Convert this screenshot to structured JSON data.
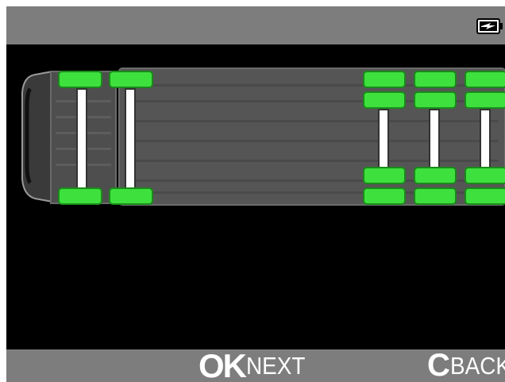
{
  "status_bar": {
    "battery_icon": "battery-charging-icon"
  },
  "vehicle": {
    "axle_count": 5,
    "tire_status_color": "#3ee03e",
    "body_color": "#5a5a5a"
  },
  "softkeys": {
    "ok_key": "OK",
    "ok_label": "NEXT",
    "back_key": "C",
    "back_label": "BACK"
  },
  "colors": {
    "bar_background": "#7d7d7d",
    "screen_background": "#000000",
    "tire_ok": "#3ee03e",
    "text": "#ffffff"
  }
}
